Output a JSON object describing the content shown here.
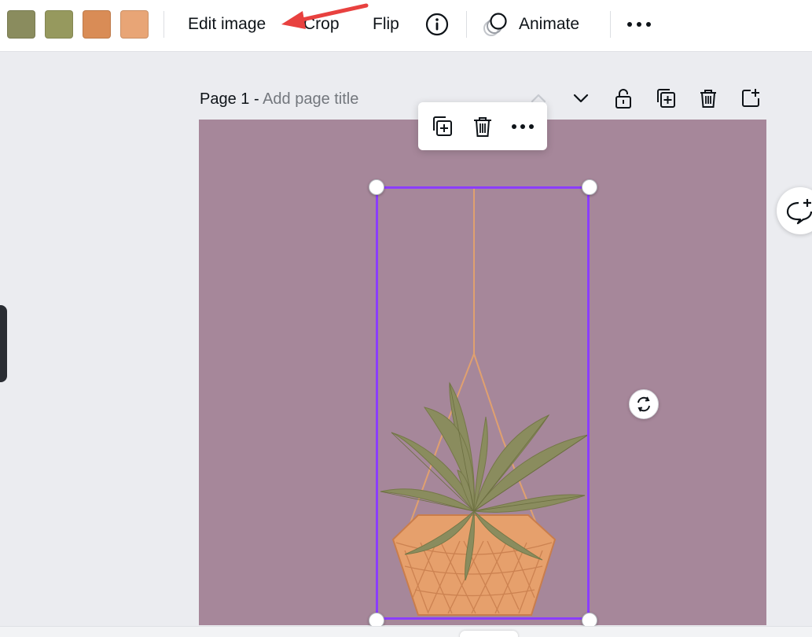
{
  "toolbar": {
    "swatches": [
      {
        "name": "color-swatch-1",
        "color": "#8a8c5e"
      },
      {
        "name": "color-swatch-2",
        "color": "#96995e"
      },
      {
        "name": "color-swatch-3",
        "color": "#d98c56"
      },
      {
        "name": "color-swatch-4",
        "color": "#e8a576"
      }
    ],
    "edit_image_label": "Edit image",
    "crop_label": "Crop",
    "flip_label": "Flip",
    "info_icon": "info-icon",
    "animate_label": "Animate",
    "animate_icon": "animate-icon",
    "more_icon": "more-icon"
  },
  "page": {
    "number_label": "Page 1 -",
    "title_placeholder": "Add page title",
    "header_icons": [
      "chevron-up-icon",
      "chevron-down-icon",
      "unlock-icon",
      "duplicate-page-icon",
      "delete-page-icon",
      "add-page-icon"
    ]
  },
  "canvas": {
    "background_color": "#a6879a",
    "selection_color": "#8b3dff"
  },
  "context_menu": {
    "icons": [
      "duplicate-icon",
      "delete-icon",
      "more-icon"
    ]
  },
  "annotation": {
    "arrow_color": "#e8413f"
  }
}
